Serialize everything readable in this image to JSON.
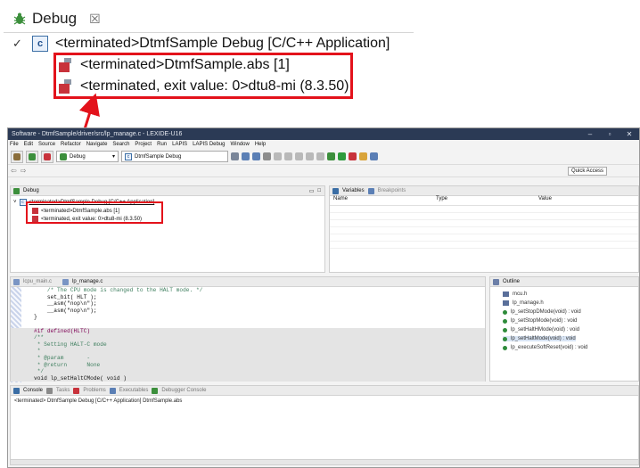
{
  "zoom": {
    "tab_title": "Debug",
    "close_glyph": "☒",
    "tree_root": "<terminated>DtmfSample Debug [C/C++ Application]",
    "child_1": "<terminated>DtmfSample.abs [1]",
    "child_2": "<terminated, exit value: 0>dtu8-mi (8.3.50)"
  },
  "window": {
    "title": "Software - DtmfSample/driver/src/lp_manage.c - LEXIDE-U16",
    "btn_min": "–",
    "btn_max": "▫",
    "btn_close": "✕"
  },
  "menus": [
    "File",
    "Edit",
    "Source",
    "Refactor",
    "Navigate",
    "Search",
    "Project",
    "Run",
    "LAPIS",
    "LAPIS Debug",
    "Window",
    "Help"
  ],
  "toolbar": {
    "launch_mode": "Debug",
    "launch_config": "DtmfSample Debug",
    "quick_access": "Quick Access"
  },
  "debug_view": {
    "tab": "Debug",
    "root": "<terminated>DtmfSample Debug [C/C++ Application]",
    "child_1": "<terminated>DtmfSample.abs [1]",
    "child_2": "<terminated, exit value: 0>dtu8-mi (8.3.50)"
  },
  "variables_view": {
    "tab_variables": "Variables",
    "tab_breakpoints": "Breakpoints",
    "col_name": "Name",
    "col_type": "Type",
    "col_value": "Value"
  },
  "editor": {
    "tab_1": "lcpu_main.c",
    "tab_2": "lp_manage.c",
    "lines": [
      "    /* The CPU mode is changed to the HALT mode. */",
      "    set_bit( HLT );",
      "    __asm(\"nop\\n\");",
      "    __asm(\"nop\\n\");",
      "}",
      "",
      "#if defined(HLTC)",
      "/**",
      " * Setting HALT-C mode",
      " *",
      " * @param       -",
      " * @return      None",
      " */",
      "void lp_setHaltCMode( void )"
    ]
  },
  "outline_view": {
    "tab": "Outline",
    "items": [
      {
        "label": "mcu.h",
        "kind": "include"
      },
      {
        "label": "lp_manage.h",
        "kind": "include"
      },
      {
        "label": "lp_setStopDMode(void) : void",
        "kind": "function"
      },
      {
        "label": "lp_setStopMode(void) : void",
        "kind": "function"
      },
      {
        "label": "lp_setHaltHMode(void) : void",
        "kind": "function"
      },
      {
        "label": "lp_setHaltMode(void) : void",
        "kind": "function"
      },
      {
        "label": "lp_executeSoftReset(void) : void",
        "kind": "function"
      }
    ]
  },
  "console_view": {
    "tab_console": "Console",
    "tab_tasks": "Tasks",
    "tab_problems": "Problems",
    "tab_executables": "Executables",
    "tab_debugger_console": "Debugger Console",
    "line": "<terminated> DtmfSample Debug [C/C++ Application] DtmfSample.abs"
  },
  "colors": {
    "highlight": "#e3121b",
    "terminated_icon": "#c8323b",
    "titlebar": "#2b3a55"
  }
}
